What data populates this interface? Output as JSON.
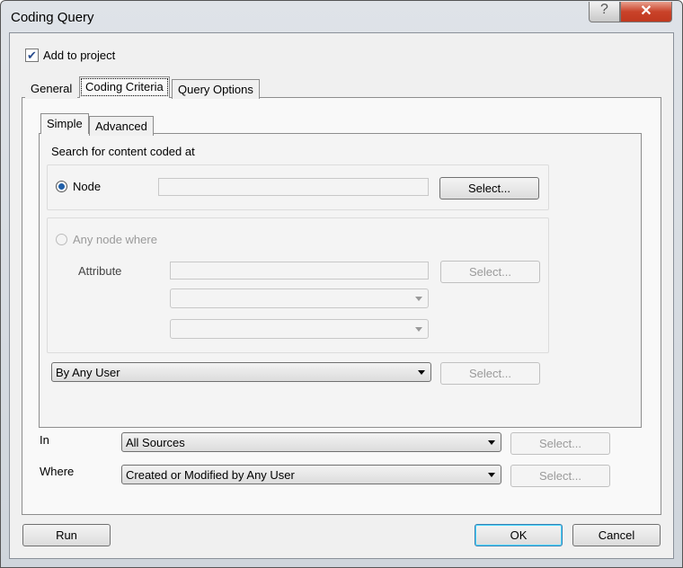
{
  "window": {
    "title": "Coding Query",
    "help": "?",
    "close": "✕"
  },
  "add_to_project": {
    "label": "Add to project",
    "checked": true
  },
  "tabs": [
    {
      "label": "General"
    },
    {
      "label": "Coding Criteria",
      "active": true
    },
    {
      "label": "Query Options"
    }
  ],
  "subtabs": [
    {
      "label": "Simple",
      "active": true
    },
    {
      "label": "Advanced"
    }
  ],
  "search_label": "Search for content coded at",
  "node": {
    "label": "Node",
    "selected": true,
    "value": "",
    "select": "Select..."
  },
  "any_node": {
    "label": "Any node where",
    "selected": false,
    "attribute_label": "Attribute",
    "attribute_value": "",
    "select": "Select...",
    "combo1": "",
    "combo2": ""
  },
  "user": {
    "value": "By Any User",
    "select": "Select..."
  },
  "in": {
    "label": "In",
    "value": "All Sources",
    "select": "Select..."
  },
  "where": {
    "label": "Where",
    "value": "Created or Modified by Any User",
    "select": "Select..."
  },
  "footer": {
    "run": "Run",
    "ok": "OK",
    "cancel": "Cancel"
  }
}
